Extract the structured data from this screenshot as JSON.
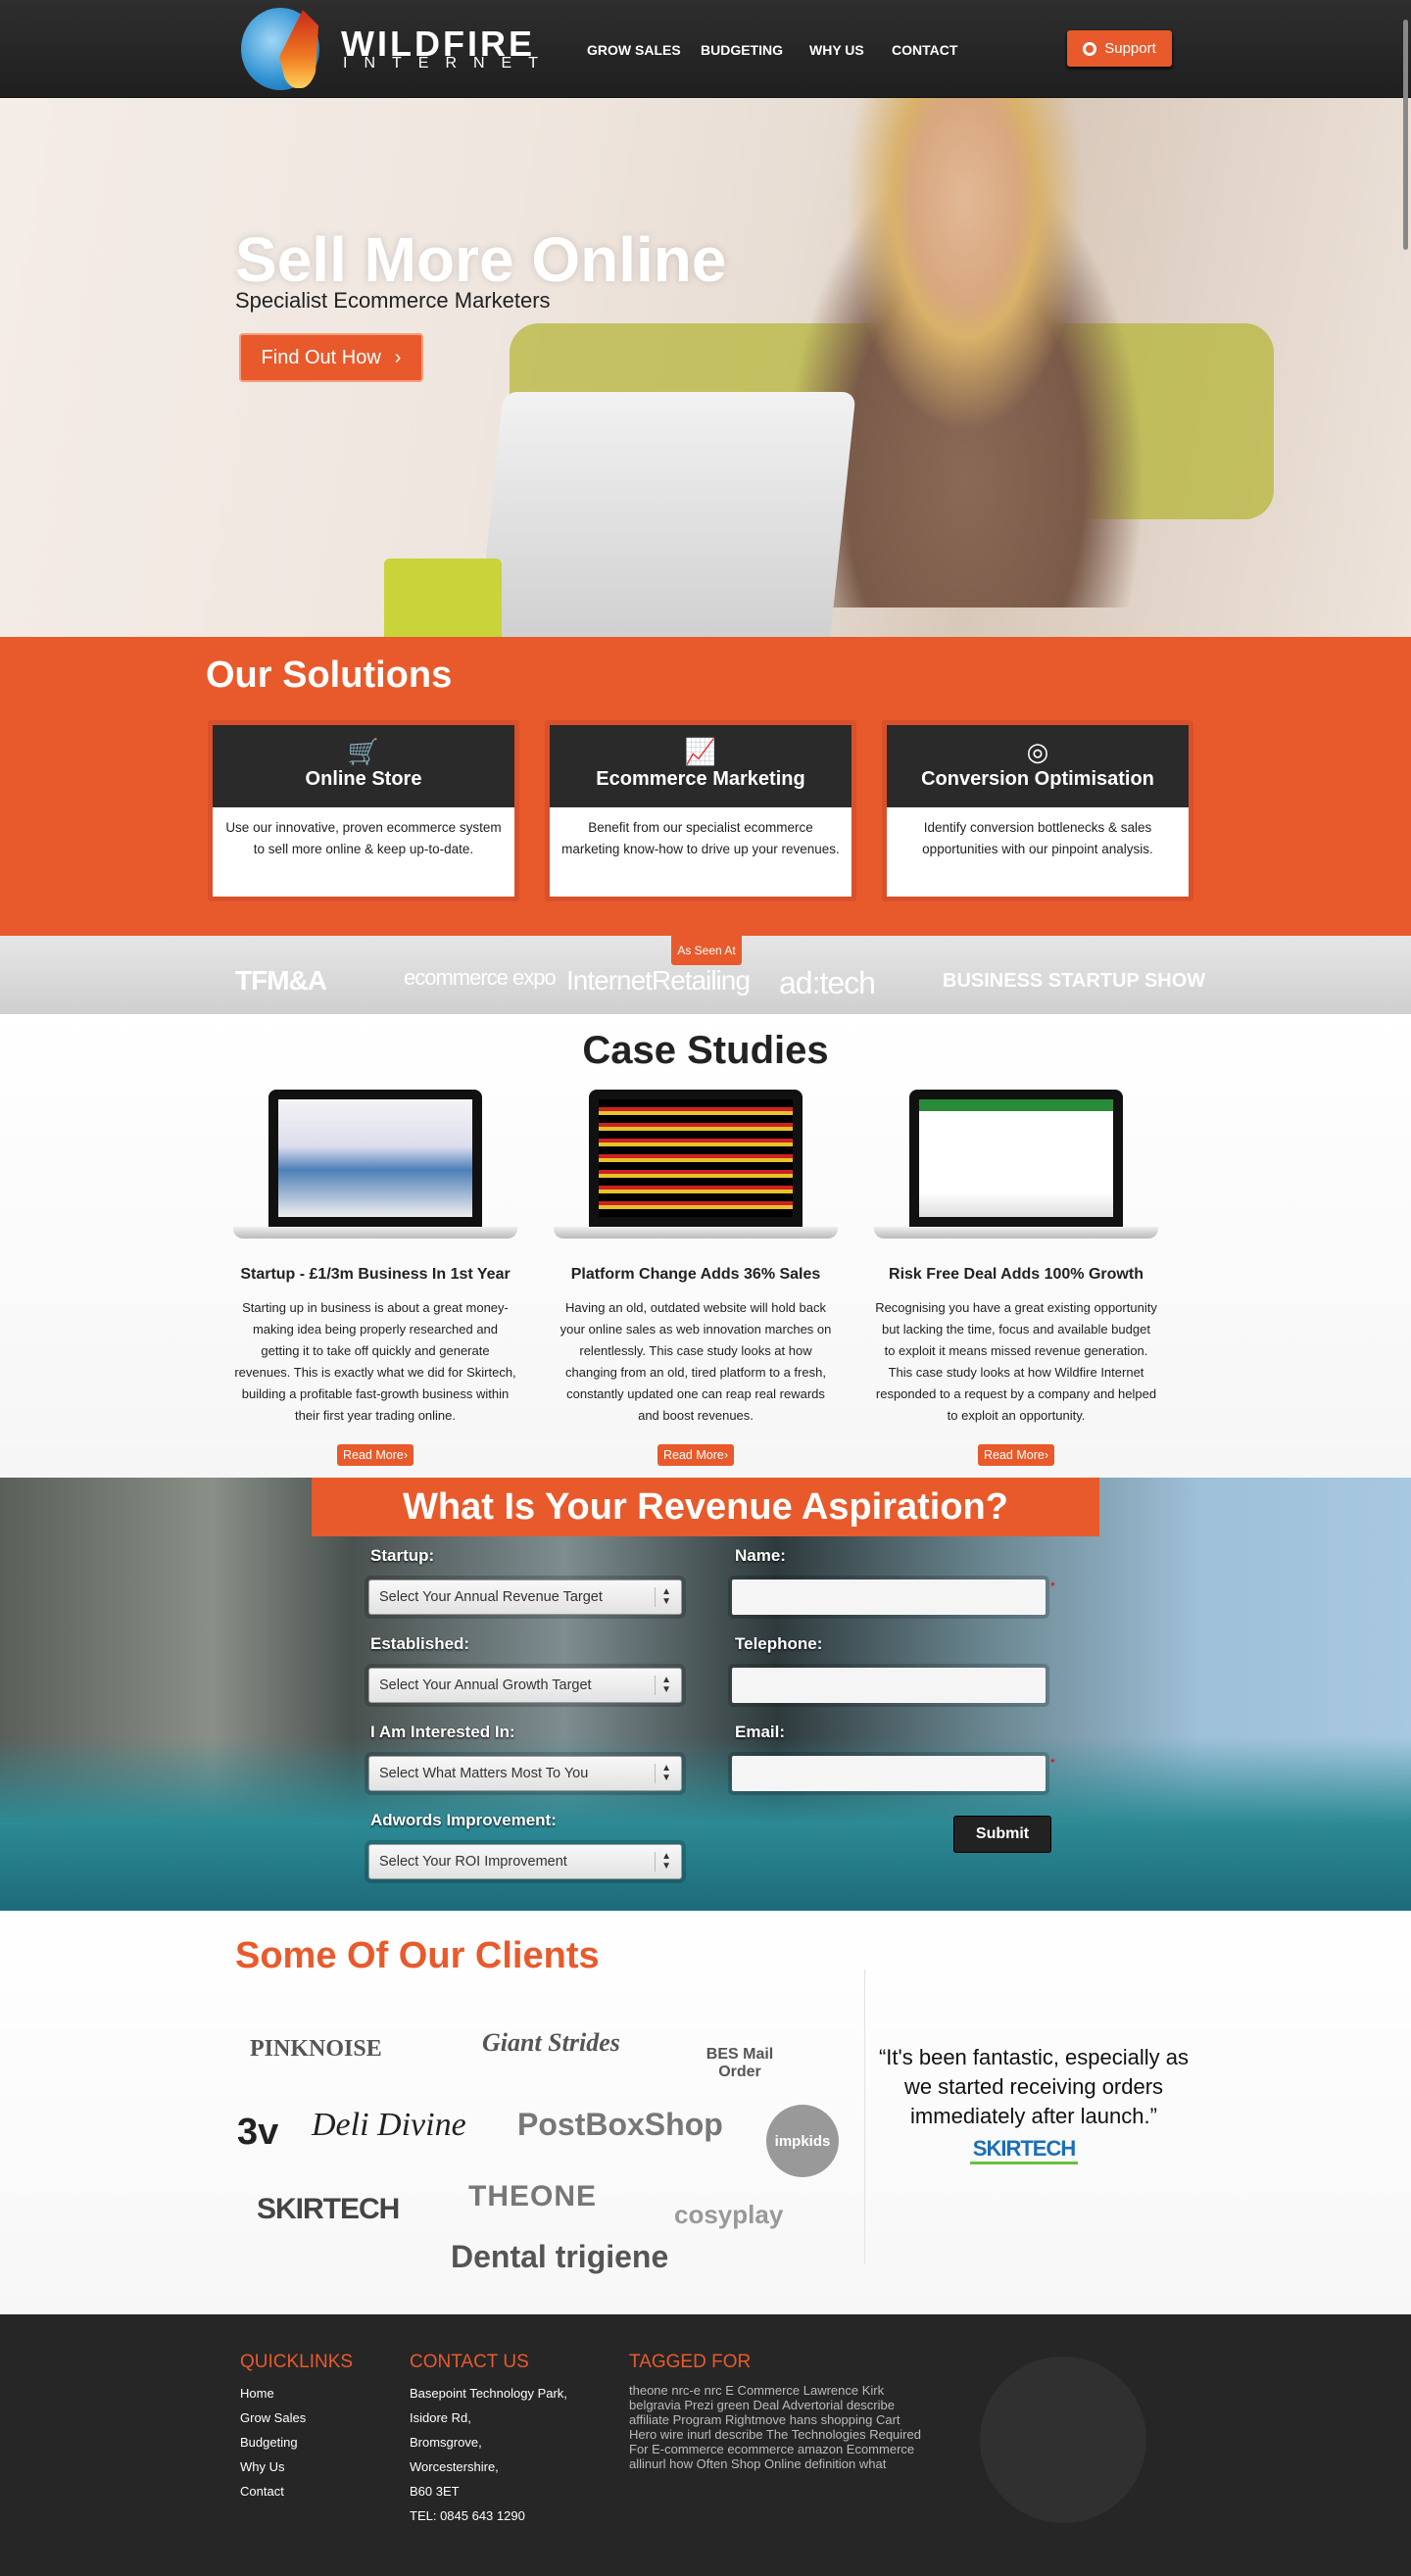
{
  "header": {
    "logo_line1": "WILDFIRE",
    "logo_line2": "INTERNET",
    "nav": [
      "GROW SALES",
      "BUDGETING",
      "WHY US",
      "CONTACT"
    ],
    "support_label": "Support",
    "support_icon": "lifebuoy-icon"
  },
  "hero": {
    "title": "Sell More Online",
    "subtitle": "Specialist Ecommerce Marketers",
    "cta": "Find Out How",
    "cta_icon": "chevron-right"
  },
  "solutions": {
    "title": "Our Solutions",
    "cards": [
      {
        "icon": "shopping-cart-icon",
        "glyph": "🛒",
        "title": "Online Store",
        "text": "Use our innovative, proven ecommerce system to sell more online & keep up-to-date."
      },
      {
        "icon": "line-chart-icon",
        "glyph": "📈",
        "title": "Ecommerce Marketing",
        "text": "Benefit from our specialist ecommerce marketing know-how to drive up your revenues."
      },
      {
        "icon": "target-icon",
        "glyph": "◎",
        "title": "Conversion Optimisation",
        "text": "Identify conversion bottlenecks & sales opportunities with our pinpoint analysis."
      }
    ]
  },
  "seen_at": {
    "tag": "As Seen At",
    "logos": [
      "TFM&A",
      "ecommerce expo",
      "InternetRetailing",
      "ad:tech",
      "BUSINESS STARTUP SHOW"
    ]
  },
  "cases": {
    "title": "Case Studies",
    "read_more": "Read More›",
    "items": [
      {
        "title": "Startup - £1/3m Business In 1st Year",
        "text": "Starting up in business is about a great money-making idea being properly researched and getting it to take off quickly and generate revenues. This is exactly what we did for Skirtech, building a profitable fast-growth business within their first year trading online."
      },
      {
        "title": "Platform Change Adds 36% Sales",
        "text": "Having an old, outdated website will hold back your online sales as web innovation marches on relentlessly. This case study looks at how changing from an old, tired platform to a fresh, constantly updated one can reap real rewards and boost revenues."
      },
      {
        "title": "Risk Free Deal Adds 100% Growth",
        "text": "Recognising you have a great existing opportunity but lacking the time, focus and available budget to exploit it means missed revenue generation. This case study looks at how Wildfire Internet responded to a request by a company and helped to exploit an opportunity."
      }
    ]
  },
  "form": {
    "title": "What Is Your Revenue Aspiration?",
    "selects": [
      {
        "label": "Startup:",
        "value": "Select Your Annual Revenue Target"
      },
      {
        "label": "Established:",
        "value": "Select Your Annual Growth Target"
      },
      {
        "label": "I Am Interested In:",
        "value": "Select What Matters Most To You"
      },
      {
        "label": "Adwords Improvement:",
        "value": "Select Your ROI Improvement"
      }
    ],
    "inputs": [
      {
        "label": "Name:",
        "value": "",
        "required": "*"
      },
      {
        "label": "Telephone:",
        "value": ""
      },
      {
        "label": "Email:",
        "value": "",
        "required": "*"
      }
    ],
    "submit": "Submit"
  },
  "clients": {
    "title": "Some Of Our Clients",
    "logos": [
      "PINKNOISE",
      "Giant Strides",
      "BES Mail Order",
      "3v",
      "Deli Divine",
      "PostBoxShop",
      "impkids",
      "SKIRTECH",
      "THEONE",
      "cosyplay",
      "Dental trigiene"
    ],
    "quote": "“It's been fantastic, especially as we started receiving orders immediately after launch.”",
    "quote_logo": "SKIRTECH"
  },
  "footer": {
    "quicklinks_title": "QUICKLINKS",
    "quicklinks": [
      "Home",
      "Grow Sales",
      "Budgeting",
      "Why Us",
      "Contact"
    ],
    "contact_title": "CONTACT US",
    "contact": [
      "Basepoint Technology Park,",
      "Isidore Rd,",
      "Bromsgrove,",
      "Worcestershire,",
      "B60 3ET",
      "TEL: 0845 643 1290"
    ],
    "tagged_title": "TAGGED FOR",
    "tags": "theone nrc-e nrc E Commerce Lawrence Kirk belgravia Prezi green Deal Advertorial describe affiliate Program Rightmove hans shopping Cart Hero wire inurl describe The Technologies Required For E-commerce ecommerce amazon Ecommerce allinurl how Often Shop Online definition what Different Choices Does Ecommerce Have ecommerce Jobs Nottingham rightmove Affiliates iceland Ecommerce Support Advisor different ebay the Scope Of E Business And Ecommerce"
  },
  "colors": {
    "accent": "#e85a2b",
    "dark": "#262626"
  }
}
